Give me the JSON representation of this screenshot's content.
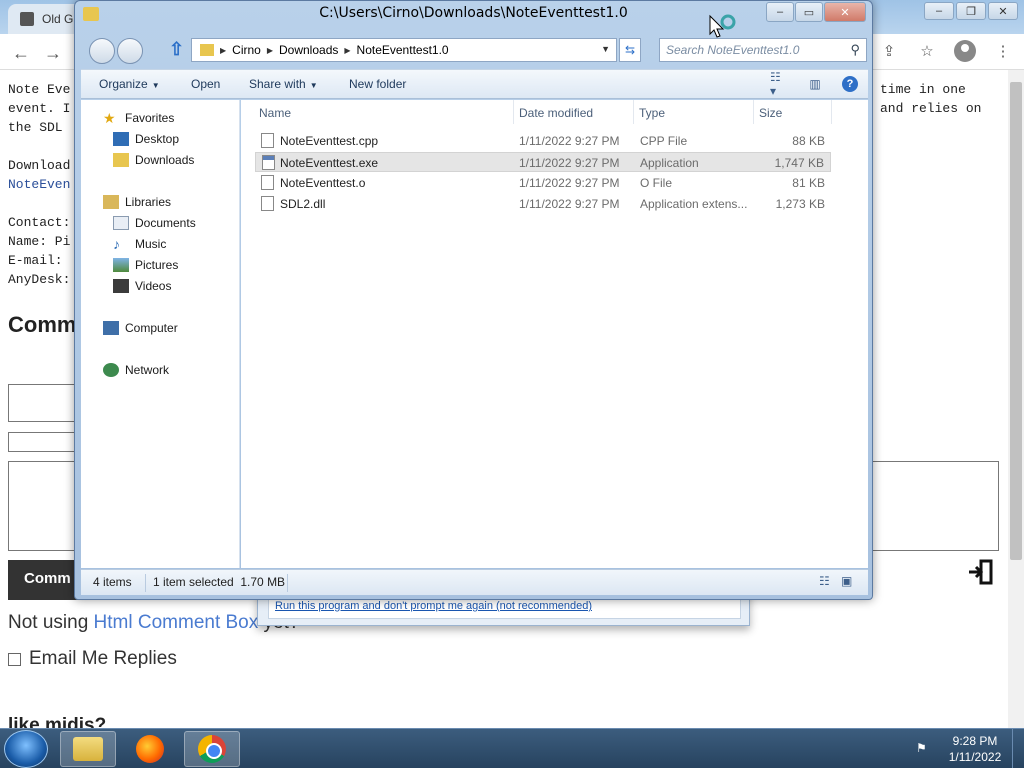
{
  "browser": {
    "tab_title": "Old G",
    "page": {
      "intro_lines": [
        "Note Eve",
        "event. I",
        "the SDL "
      ],
      "intro_right_lines": [
        "time in one",
        "and relies on"
      ],
      "download_label": "Download",
      "download_link": "NoteEven",
      "contact_lines": [
        "Contact:",
        "Name: Pi",
        "E-mail: ",
        "AnyDesk:"
      ],
      "comments_heading": "Comm",
      "submit_label": "Comm",
      "not_using_prefix": "Not using ",
      "not_using_link": "Html Comment Box",
      "not_using_suffix": " yet?",
      "email_replies_label": "Email Me Replies",
      "like_midis": "like midis?"
    }
  },
  "run_dialog": {
    "link_text": "Run this program and don't prompt me again (not recommended)"
  },
  "explorer": {
    "title": "C:\\Users\\Cirno\\Downloads\\NoteEventtest1.0",
    "breadcrumb": [
      "Cirno",
      "Downloads",
      "NoteEventtest1.0"
    ],
    "search_placeholder": "Search NoteEventtest1.0",
    "commands": {
      "organize": "Organize",
      "open": "Open",
      "share_with": "Share with",
      "new_folder": "New folder"
    },
    "nav": {
      "favorites": "Favorites",
      "desktop": "Desktop",
      "downloads": "Downloads",
      "libraries": "Libraries",
      "documents": "Documents",
      "music": "Music",
      "pictures": "Pictures",
      "videos": "Videos",
      "computer": "Computer",
      "network": "Network"
    },
    "columns": {
      "name": "Name",
      "date_modified": "Date modified",
      "type": "Type",
      "size": "Size"
    },
    "files": [
      {
        "name": "NoteEventtest.cpp",
        "date": "1/11/2022 9:27 PM",
        "type": "CPP File",
        "size": "88 KB"
      },
      {
        "name": "NoteEventtest.exe",
        "date": "1/11/2022 9:27 PM",
        "type": "Application",
        "size": "1,747 KB"
      },
      {
        "name": "NoteEventtest.o",
        "date": "1/11/2022 9:27 PM",
        "type": "O File",
        "size": "81 KB"
      },
      {
        "name": "SDL2.dll",
        "date": "1/11/2022 9:27 PM",
        "type": "Application extens...",
        "size": "1,273 KB"
      }
    ],
    "status": {
      "count": "4 items",
      "selection": "1 item selected  1.70 MB"
    }
  },
  "taskbar": {
    "time": "9:28 PM",
    "date": "1/11/2022"
  }
}
